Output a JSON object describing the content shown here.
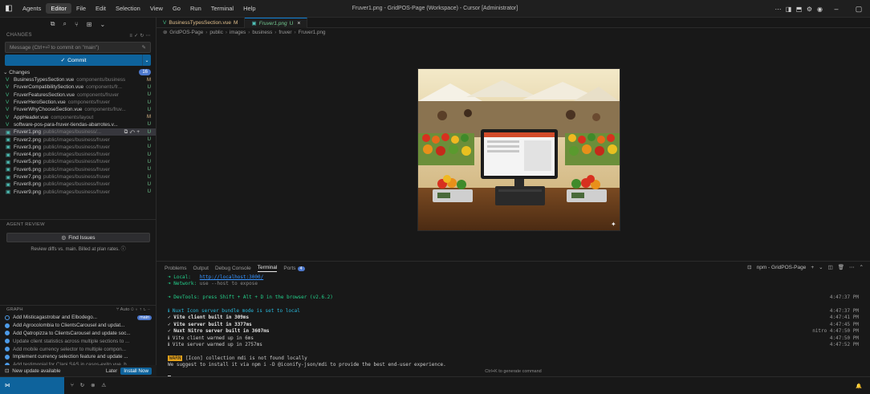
{
  "titlebar": {
    "menus": [
      "Agents",
      "Editor",
      "File",
      "Edit",
      "Selection",
      "View",
      "Go",
      "Run",
      "Terminal",
      "Help"
    ],
    "active_menu": "Editor",
    "title": "Fruver1.png - GridPOS-Page (Workspace) - Cursor [Administrator]"
  },
  "sidebar": {
    "changes_header": "CHANGES",
    "commit_placeholder": "Message (Ctrl+⏎ to commit on \"main\")",
    "commit_label": "Commit",
    "changes_label": "Changes",
    "changes_count": "16",
    "files": [
      {
        "name": "BusinessTypesSection.vue",
        "path": "components/business",
        "status": "M",
        "type": "vue"
      },
      {
        "name": "FruverCompatibilitySection.vue",
        "path": "components/fr...",
        "status": "U",
        "type": "vue"
      },
      {
        "name": "FruverFeaturesSection.vue",
        "path": "components/fruver",
        "status": "U",
        "type": "vue"
      },
      {
        "name": "FruverHeroSection.vue",
        "path": "components/fruver",
        "status": "U",
        "type": "vue"
      },
      {
        "name": "FruverWhyChooseSection.vue",
        "path": "components/fruv...",
        "status": "U",
        "type": "vue"
      },
      {
        "name": "AppHeader.vue",
        "path": "components/layout",
        "status": "M",
        "type": "vue"
      },
      {
        "name": "software-pos-para-fruver-tiendas-abarrotes.v...",
        "path": "",
        "status": "U",
        "type": "vue"
      },
      {
        "name": "Fruver1.png",
        "path": "public/images/business/...",
        "status": "U",
        "type": "img",
        "selected": true
      },
      {
        "name": "Fruver2.png",
        "path": "public/images/business/fruver",
        "status": "U",
        "type": "img"
      },
      {
        "name": "Fruver3.png",
        "path": "public/images/business/fruver",
        "status": "U",
        "type": "img"
      },
      {
        "name": "Fruver4.png",
        "path": "public/images/business/fruver",
        "status": "U",
        "type": "img"
      },
      {
        "name": "Fruver5.png",
        "path": "public/images/business/fruver",
        "status": "U",
        "type": "img"
      },
      {
        "name": "Fruver6.png",
        "path": "public/images/business/fruver",
        "status": "U",
        "type": "img"
      },
      {
        "name": "Fruver7.png",
        "path": "public/images/business/fruver",
        "status": "U",
        "type": "img"
      },
      {
        "name": "Fruver8.png",
        "path": "public/images/business/fruver",
        "status": "U",
        "type": "img"
      },
      {
        "name": "Fruver9.png",
        "path": "public/images/business/fruver",
        "status": "U",
        "type": "img"
      }
    ],
    "agent_review_title": "AGENT REVIEW",
    "find_issues_label": "Find Issues",
    "review_note": "Review diffs vs. main. Billed at plan rates.",
    "graph_title": "GRAPH",
    "graph_auto": "Auto",
    "graph_branch": "main",
    "graph_rows": [
      {
        "msg": "Add Misticagastrobar and Elbodego...",
        "dim": false,
        "badge": true
      },
      {
        "msg": "Add Agrocolombia to ClientsCarousel and updat...",
        "dim": false
      },
      {
        "msg": "Add Qatropizza to ClientsCarousel and update soc...",
        "dim": false
      },
      {
        "msg": "Update client statistics across multiple sections to ...",
        "dim": true
      },
      {
        "msg": "Add mobile currency selector to multiple compon...",
        "dim": true
      },
      {
        "msg": "Implement currency selection feature and update ...",
        "dim": false
      },
      {
        "msg": "Add testimonial for Clapi SAS in casos-exito.vue, h...",
        "dim": true
      }
    ],
    "update_text": "New update available",
    "later_label": "Later",
    "install_label": "Install Now"
  },
  "editor": {
    "tabs": [
      {
        "name": "BusinessTypesSection.vue",
        "flag": "M",
        "active": false
      },
      {
        "name": "Fruver1.png",
        "flag": "U",
        "active": true
      }
    ],
    "breadcrumb": [
      "GridPOS-Page",
      "public",
      "images",
      "business",
      "fruver",
      "Fruver1.png"
    ]
  },
  "panel": {
    "tabs": [
      "Problems",
      "Output",
      "Debug Console",
      "Terminal",
      "Ports"
    ],
    "active_tab": "Terminal",
    "ports_count": "4",
    "terminal_name": "npm - GridPOS-Page",
    "lines": {
      "local_label": "➜ Local:",
      "local_url": "http://localhost:3000/",
      "network_label": "➜ Network:",
      "network_text": "use --host to expose",
      "devtools": "➜ DevTools: press Shift + Alt + D in the browser (v2.6.2)",
      "devtools_time": "4:47:37 PM",
      "l1": "ℹ Nuxt Icon server bundle mode is set to local",
      "l1_time": "4:47:37 PM",
      "l2": "✓ Vite client built in 309ms",
      "l2_time": "4:47:41 PM",
      "l3": "✓ Vite server built in 3377ms",
      "l3_time": "4:47:45 PM",
      "l4": "✓ Nuxt Nitro server built in 3607ms",
      "l4_time": "nitro 4:47:50 PM",
      "l5": "ℹ Vite client warmed up in 6ms",
      "l5_time": "4:47:50 PM",
      "l6": "ℹ Vite server warmed up in 2757ms",
      "l6_time": "4:47:52 PM",
      "warn_tag": "WARN",
      "warn_text": " [Icon] collection mdi is not found locally",
      "suggest": "We suggest to install it via npm i -D @iconify-json/mdi to provide the best end-user experience."
    },
    "hint": "Ctrl+K to generate command"
  },
  "colors": {
    "accent": "#0e639c",
    "modified": "#e2c08d",
    "untracked": "#73c991"
  }
}
